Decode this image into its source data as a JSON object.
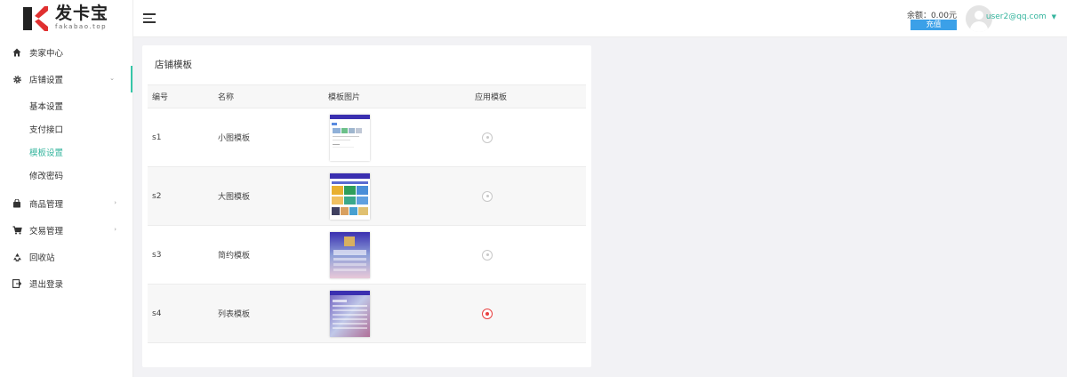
{
  "brand": {
    "title": "发卡宝",
    "subtitle": "fakabao.top"
  },
  "sidebar": {
    "items": [
      {
        "label": "卖家中心",
        "icon": "home-icon"
      },
      {
        "label": "店铺设置",
        "icon": "gear-icon",
        "expanded": true,
        "children": [
          {
            "label": "基本设置"
          },
          {
            "label": "支付接口"
          },
          {
            "label": "模板设置",
            "active": true
          },
          {
            "label": "修改密码"
          }
        ]
      },
      {
        "label": "商品管理",
        "icon": "bag-icon"
      },
      {
        "label": "交易管理",
        "icon": "cart-icon"
      },
      {
        "label": "回收站",
        "icon": "recycle-icon"
      },
      {
        "label": "退出登录",
        "icon": "logout-icon"
      }
    ]
  },
  "header": {
    "balance": "余额：0.00元",
    "recharge_label": "充值",
    "user_email": "user2@qq.com"
  },
  "card": {
    "title": "店铺模板",
    "columns": [
      "编号",
      "名称",
      "模板图片",
      "应用模板"
    ],
    "rows": [
      {
        "id": "s1",
        "name": "小图模板",
        "selected": false
      },
      {
        "id": "s2",
        "name": "大图模板",
        "selected": false
      },
      {
        "id": "s3",
        "name": "简约模板",
        "selected": false
      },
      {
        "id": "s4",
        "name": "列表模板",
        "selected": true
      }
    ]
  },
  "colors": {
    "accent": "#36b59e",
    "recharge": "#3ba0e8",
    "selected_radio": "#e84040",
    "brand_red": "#e03030"
  }
}
